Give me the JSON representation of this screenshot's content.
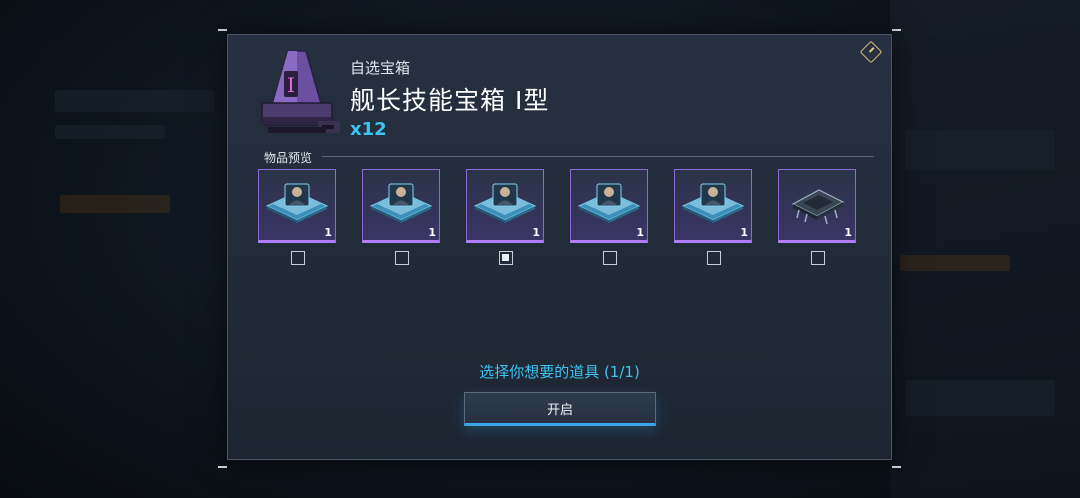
{
  "modal": {
    "subtitle": "自选宝箱",
    "title": "舰长技能宝箱 I型",
    "quantity": "x12",
    "section_label": "物品预览",
    "items": [
      {
        "kind": "skill-chip-portrait",
        "count": "1",
        "selected": false
      },
      {
        "kind": "skill-chip-portrait",
        "count": "1",
        "selected": false
      },
      {
        "kind": "skill-chip-portrait",
        "count": "1",
        "selected": true
      },
      {
        "kind": "skill-chip-portrait",
        "count": "1",
        "selected": false
      },
      {
        "kind": "skill-chip-portrait",
        "count": "1",
        "selected": false
      },
      {
        "kind": "processor-chip",
        "count": "1",
        "selected": false
      }
    ],
    "prompt": "选择你想要的道具 (1/1)",
    "open_button": "开启"
  },
  "colors": {
    "accent_blue": "#3cc4f2",
    "rarity_purple": "#b07cff",
    "info_gold": "#e1c37a"
  }
}
